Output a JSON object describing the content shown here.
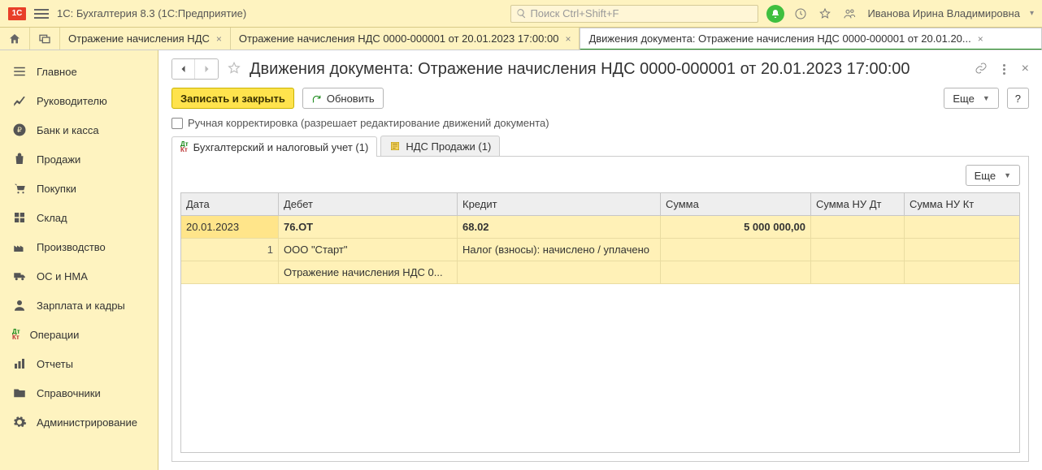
{
  "titlebar": {
    "app_title": "1С: Бухгалтерия 8.3  (1С:Предприятие)",
    "search_placeholder": "Поиск Ctrl+Shift+F",
    "username": "Иванова Ирина Владимировна"
  },
  "tabs": [
    {
      "label": "Отражение начисления НДС"
    },
    {
      "label": "Отражение начисления НДС 0000-000001 от 20.01.2023 17:00:00"
    },
    {
      "label": "Движения документа: Отражение начисления НДС 0000-000001 от 20.01.20..."
    }
  ],
  "sidebar": [
    {
      "key": "main",
      "label": "Главное"
    },
    {
      "key": "manager",
      "label": "Руководителю"
    },
    {
      "key": "bank",
      "label": "Банк и касса"
    },
    {
      "key": "sales",
      "label": "Продажи"
    },
    {
      "key": "purchases",
      "label": "Покупки"
    },
    {
      "key": "stock",
      "label": "Склад"
    },
    {
      "key": "production",
      "label": "Производство"
    },
    {
      "key": "os",
      "label": "ОС и НМА"
    },
    {
      "key": "payroll",
      "label": "Зарплата и кадры"
    },
    {
      "key": "operations",
      "label": "Операции"
    },
    {
      "key": "reports",
      "label": "Отчеты"
    },
    {
      "key": "refs",
      "label": "Справочники"
    },
    {
      "key": "admin",
      "label": "Администрирование"
    }
  ],
  "page": {
    "title": "Движения документа: Отражение начисления НДС 0000-000001 от 20.01.2023 17:00:00",
    "save_close": "Записать и закрыть",
    "refresh": "Обновить",
    "manual_label": "Ручная корректировка (разрешает редактирование движений документа)",
    "more": "Еще",
    "help": "?"
  },
  "inner_tabs": {
    "acct": "Бухгалтерский и налоговый учет (1)",
    "vat": "НДС Продажи (1)"
  },
  "grid": {
    "headers": {
      "date": "Дата",
      "debit": "Дебет",
      "credit": "Кредит",
      "sum": "Сумма",
      "nd": "Сумма НУ Дт",
      "nk": "Сумма НУ Кт"
    },
    "row1": {
      "date": "20.01.2023",
      "debit": "76.ОТ",
      "credit": "68.02",
      "sum": "5 000 000,00"
    },
    "row2": {
      "num": "1",
      "debit": "ООО \"Старт\"",
      "credit": "Налог (взносы): начислено / уплачено"
    },
    "row3": {
      "debit": "Отражение начисления НДС 0..."
    }
  }
}
